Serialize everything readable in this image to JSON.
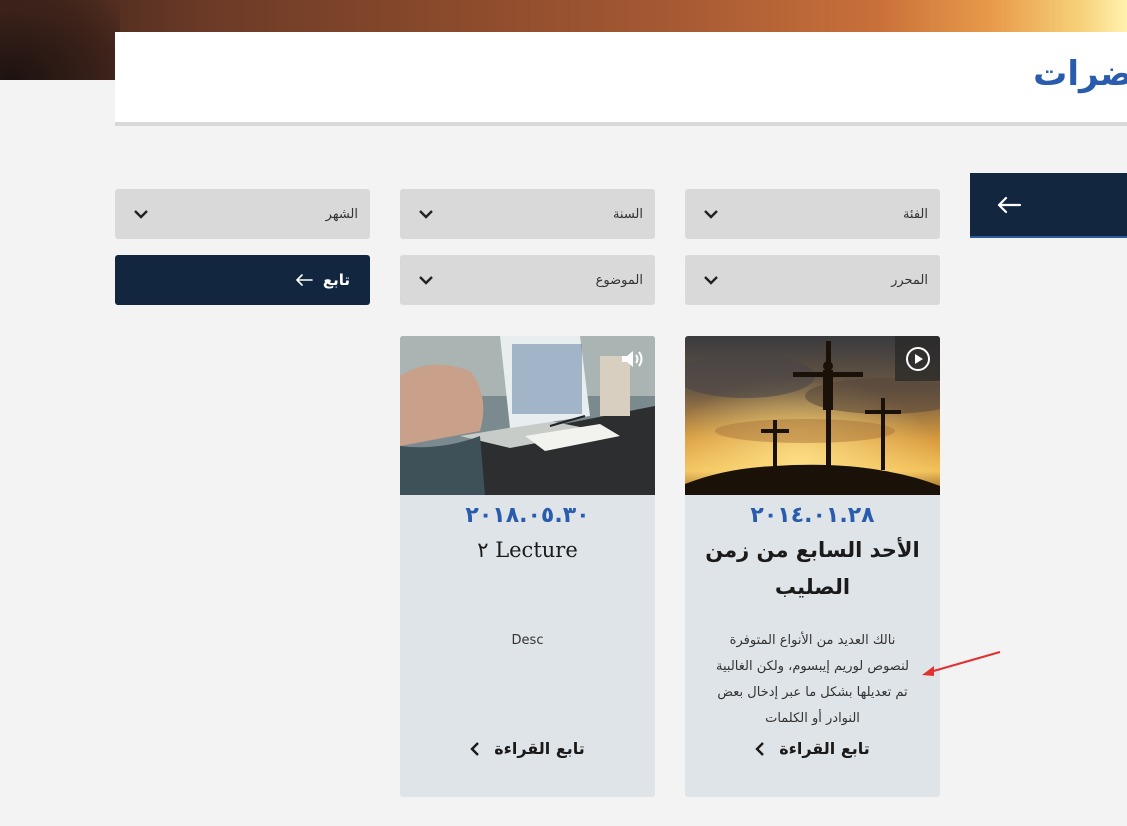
{
  "header": {
    "title": "ضرات"
  },
  "filters": {
    "category": "الفئة",
    "year": "السنة",
    "month": "الشهر",
    "editor": "المحرر",
    "topic": "الموضوع",
    "follow_label": "تابع"
  },
  "cards": [
    {
      "date": "٢٠١٤.٠١.٢٨",
      "title": "الأحد السابع من زمن الصليب",
      "desc": "نالك العديد من الأنواع المتوفرة لنصوص لوريم إيبسوم، ولكن الغالبية تم تعديلها بشكل ما عبر إدخال بعض النوادر أو الكلمات",
      "more_label": "تابع القراءة",
      "media_icon": "play-icon"
    },
    {
      "date": "٢٠١٨.٠٥.٣٠",
      "title": "Lecture ٢",
      "desc": "Desc",
      "more_label": "تابع القراءة",
      "media_icon": "speaker-icon"
    }
  ],
  "colors": {
    "navy": "#132640",
    "accent_blue": "#2a5cae",
    "card_bg": "#dfe4e9",
    "annotation_red": "#e03030"
  }
}
